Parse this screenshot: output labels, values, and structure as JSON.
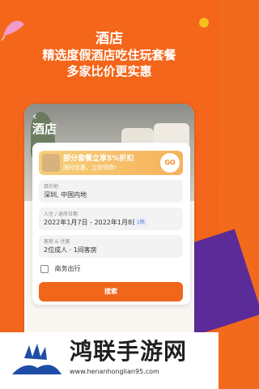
{
  "colors": {
    "brand": "#f0661a",
    "background": "#f26a1b",
    "accent_purple": "#5b2b98",
    "banner_gradient_start": "#f5cf7a",
    "banner_gradient_end": "#f6b25a"
  },
  "headline": {
    "line1": "酒店",
    "line2": "精选度假酒店吃住玩套餐",
    "line3": "多家比价更实惠"
  },
  "app": {
    "back_icon": "back-icon",
    "title": "酒店",
    "banner": {
      "title": "部分套餐立享5%折扣",
      "subtitle": "限时优惠，立即领券!",
      "go_label": "GO"
    },
    "destination": {
      "label": "目的地",
      "value": "深圳, 中国内地"
    },
    "dates": {
      "label": "入住 / 退房日期",
      "value": "2022年1月7日 - 2022年1月8日",
      "nights_badge": "1晚"
    },
    "guests": {
      "label": "客房 & 住客",
      "value": "2位成人 · 1间客房"
    },
    "business_trip_label": "商务出行",
    "search_button": "搜索"
  },
  "watermark": {
    "title": "鸿联手游网",
    "url": "www.henanhonglian95.com"
  }
}
